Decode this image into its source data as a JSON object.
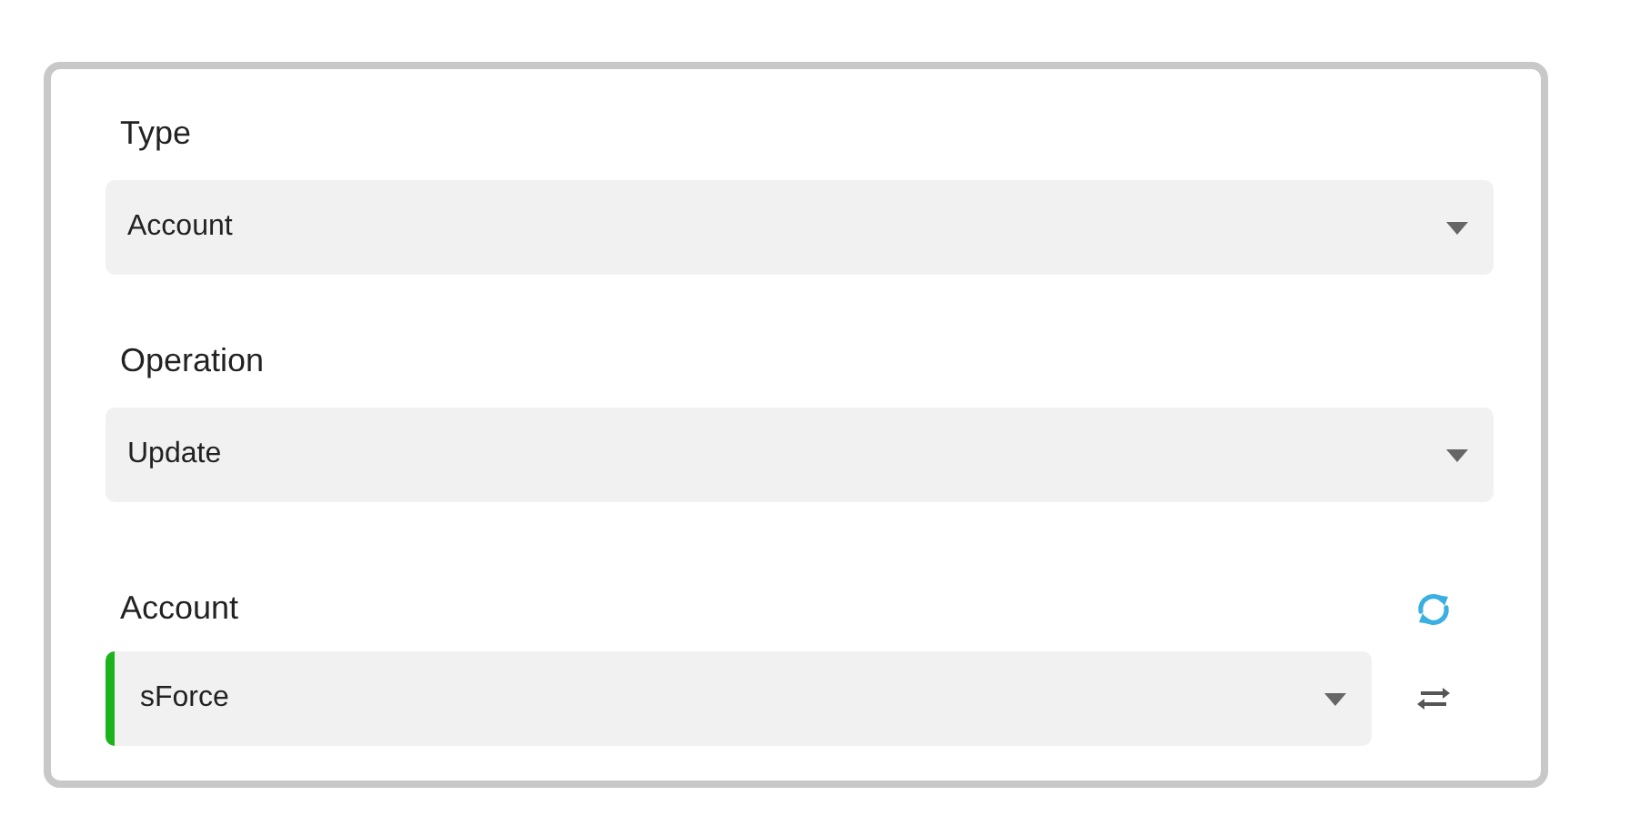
{
  "fields": [
    {
      "kind": "select",
      "label": "Type",
      "value": "Account"
    },
    {
      "kind": "select",
      "label": "Operation",
      "value": "Update"
    },
    {
      "kind": "account",
      "label": "Account",
      "value": "sForce",
      "color": "#1db31d"
    }
  ]
}
